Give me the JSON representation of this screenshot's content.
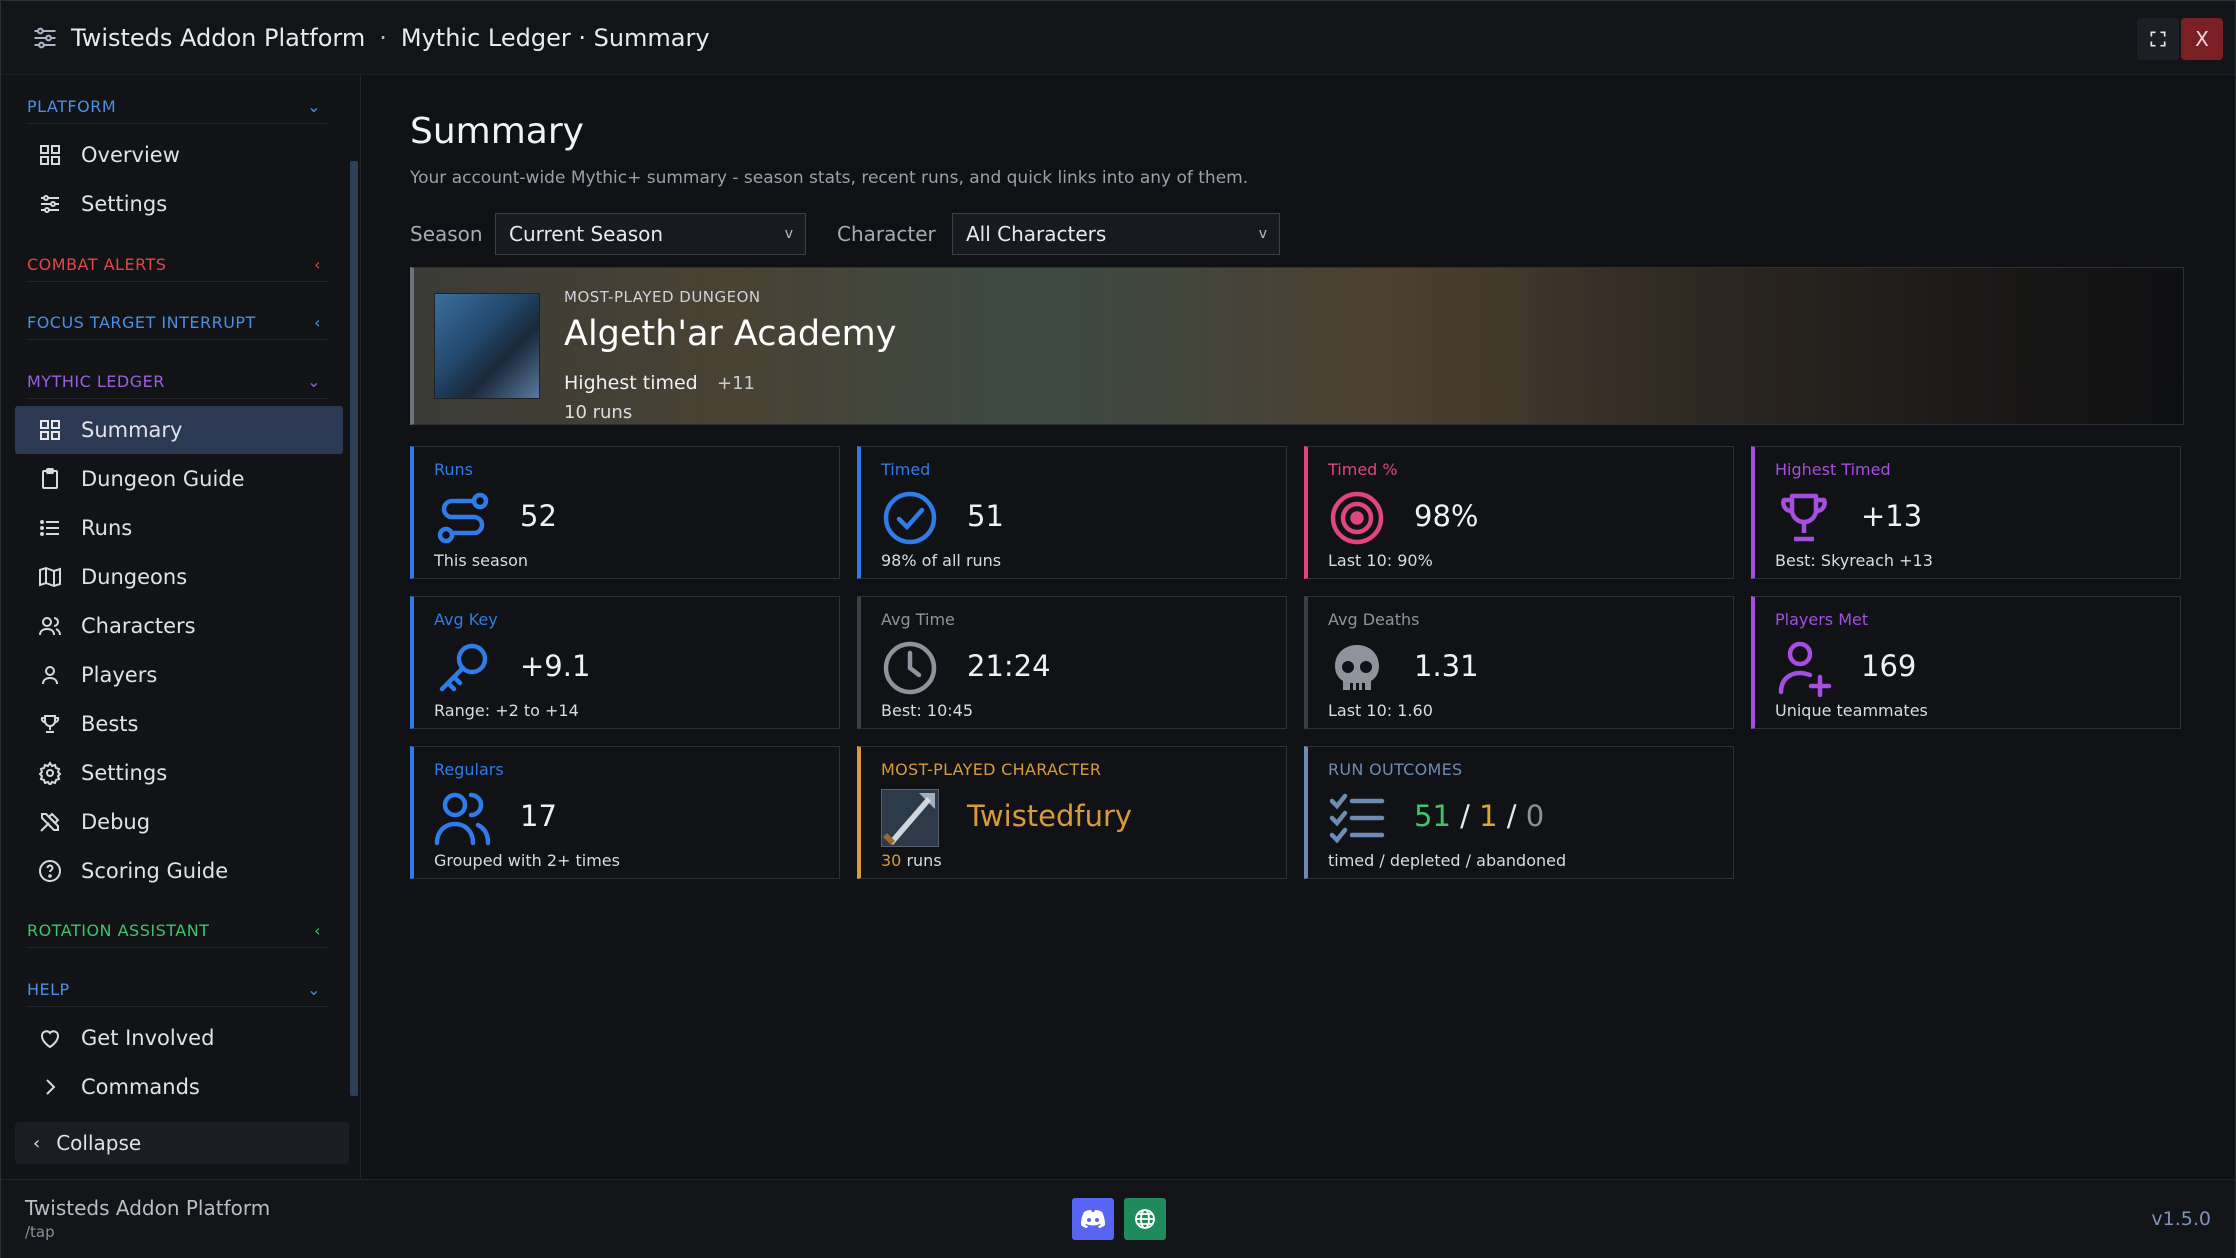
{
  "titlebar": {
    "app_name": "Twisteds Addon Platform",
    "separator": "·",
    "subtitle": "Mythic Ledger · Summary",
    "close_label": "X"
  },
  "sidebar": {
    "sections": [
      {
        "label": "PLATFORM",
        "color": "#4a90e2",
        "chevron": "⌄"
      },
      {
        "label": "COMBAT ALERTS",
        "color": "#e04848",
        "chevron": "‹"
      },
      {
        "label": "FOCUS TARGET INTERRUPT",
        "color": "#4a90e2",
        "chevron": "‹"
      },
      {
        "label": "MYTHIC LEDGER",
        "color": "#9d5fe0",
        "chevron": "⌄"
      },
      {
        "label": "ROTATION ASSISTANT",
        "color": "#3fc46a",
        "chevron": "‹"
      },
      {
        "label": "HELP",
        "color": "#4a90e2",
        "chevron": "⌄"
      }
    ],
    "items": [
      {
        "label": "Overview",
        "icon": "grid-icon"
      },
      {
        "label": "Settings",
        "icon": "sliders-icon"
      },
      {
        "label": "Summary",
        "icon": "grid-icon"
      },
      {
        "label": "Dungeon Guide",
        "icon": "clipboard-icon"
      },
      {
        "label": "Runs",
        "icon": "list-icon"
      },
      {
        "label": "Dungeons",
        "icon": "map-icon"
      },
      {
        "label": "Characters",
        "icon": "users-icon"
      },
      {
        "label": "Players",
        "icon": "user-icon"
      },
      {
        "label": "Bests",
        "icon": "trophy-icon"
      },
      {
        "label": "Settings",
        "icon": "gear-icon"
      },
      {
        "label": "Debug",
        "icon": "tools-icon"
      },
      {
        "label": "Scoring Guide",
        "icon": "help-circle-icon"
      },
      {
        "label": "Get Involved",
        "icon": "heart-icon"
      },
      {
        "label": "Commands",
        "icon": "chevron-right-icon"
      }
    ],
    "collapse_label": "Collapse"
  },
  "main": {
    "title": "Summary",
    "description": "Your account-wide Mythic+ summary - season stats, recent runs, and quick links into any of them.",
    "season_label": "Season",
    "season_value": "Current Season",
    "character_label": "Character",
    "character_value": "All Characters",
    "select_arrow": "v"
  },
  "hero": {
    "kicker": "MOST-PLAYED DUNGEON",
    "dungeon_name": "Algeth'ar Academy",
    "highest_label": "Highest timed",
    "highest_value": "+11",
    "runs": "10 runs"
  },
  "cards": {
    "runs": {
      "label": "Runs",
      "value": "52",
      "sub": "This season",
      "color": "#2f7be8"
    },
    "timed": {
      "label": "Timed",
      "value": "51",
      "sub": "98% of all runs",
      "color": "#2f7be8"
    },
    "timed_pct": {
      "label": "Timed %",
      "value": "98%",
      "sub": "Last 10: 90%",
      "color": "#e0457f"
    },
    "highest_timed": {
      "label": "Highest Timed",
      "value": "+13",
      "sub": "Best: Skyreach +13",
      "color": "#a54ee0"
    },
    "avg_key": {
      "label": "Avg Key",
      "value": "+9.1",
      "sub": "Range: +2 to +14",
      "color": "#2f7be8"
    },
    "avg_time": {
      "label": "Avg Time",
      "value": "21:24",
      "sub": "Best: 10:45",
      "color": "#8f949c"
    },
    "avg_deaths": {
      "label": "Avg Deaths",
      "value": "1.31",
      "sub": "Last 10: 1.60",
      "color": "#8f949c"
    },
    "players_met": {
      "label": "Players Met",
      "value": "169",
      "sub": "Unique teammates",
      "color": "#a54ee0"
    },
    "regulars": {
      "label": "Regulars",
      "value": "17",
      "sub": "Grouped with 2+ times",
      "color": "#2f7be8"
    },
    "most_played_char": {
      "label": "MOST-PLAYED CHARACTER",
      "name": "Twistedfury",
      "runs_count": "30",
      "runs_word": "runs",
      "color": "#d89a3c"
    },
    "run_outcomes": {
      "label": "RUN OUTCOMES",
      "timed": "51",
      "depleted": "1",
      "abandoned": "0",
      "slash": "/",
      "sub": "timed / depleted / abandoned",
      "color": "#6f8bb4"
    }
  },
  "footer": {
    "name": "Twisteds Addon Platform",
    "command": "/tap",
    "version": "v1.5.0"
  }
}
